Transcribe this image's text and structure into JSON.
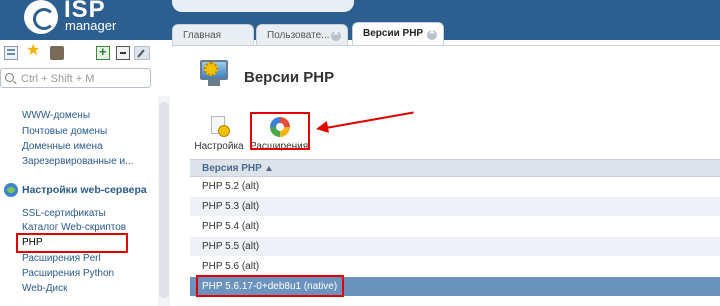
{
  "app": {
    "logo": {
      "brand_top": "ISP",
      "brand_bottom": "manager"
    }
  },
  "search": {
    "placeholder": "Ctrl + Shift + M"
  },
  "sidebar": {
    "items_top": [
      {
        "label": "WWW-домены"
      },
      {
        "label": "Почтовые домены"
      },
      {
        "label": "Доменные имена"
      },
      {
        "label": "Зарезервированные и..."
      }
    ],
    "section": {
      "label": "Настройки web-сервера",
      "icon": "globe-icon"
    },
    "items_section": [
      {
        "label": "SSL-сертификаты"
      },
      {
        "label": "Каталог Web-скриптов"
      },
      {
        "label": "PHP",
        "active": true
      },
      {
        "label": "Расширения Perl"
      },
      {
        "label": "Расширения Python"
      },
      {
        "label": "Web-Диск"
      }
    ]
  },
  "tabs": [
    {
      "label": "Главная",
      "closable": false
    },
    {
      "label": "Пользовате...",
      "closable": true
    },
    {
      "label": "Версии PHP",
      "closable": true,
      "active": true
    }
  ],
  "page": {
    "title": "Версии PHP",
    "actions": [
      {
        "label": "Настройка",
        "icon": "settings-icon"
      },
      {
        "label": "Расширения",
        "icon": "extensions-icon",
        "highlighted": true
      }
    ]
  },
  "table": {
    "columns": [
      {
        "label": "Версия PHP",
        "sort": "asc"
      }
    ],
    "rows": [
      {
        "version": "PHP 5.2 (alt)"
      },
      {
        "version": "PHP 5.3 (alt)"
      },
      {
        "version": "PHP 5.4 (alt)"
      },
      {
        "version": "PHP 5.5 (alt)"
      },
      {
        "version": "PHP 5.6 (alt)"
      },
      {
        "version": "PHP 5.6.17-0+deb8u1 (native)",
        "selected": true
      }
    ]
  },
  "colors": {
    "header_bg": "#2c5e8f",
    "link": "#2a5a8c",
    "selected_row": "#6c93bd",
    "annotation_red": "#e00000"
  }
}
